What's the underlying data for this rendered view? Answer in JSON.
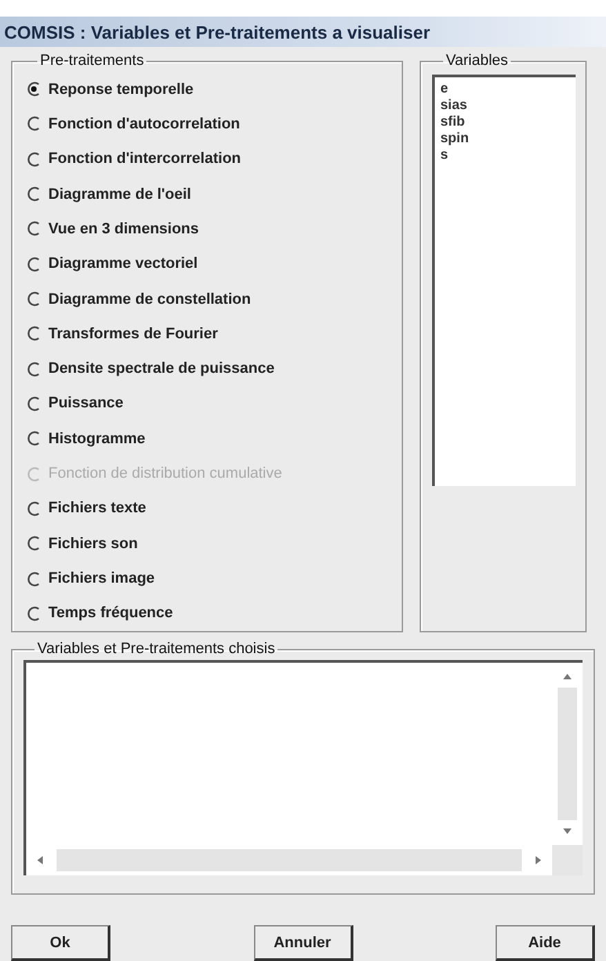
{
  "window": {
    "title": "COMSIS : Variables et Pre-traitements a visualiser"
  },
  "pretraitements": {
    "title": "Pre-traitements",
    "options": [
      {
        "label": "Reponse temporelle",
        "selected": true,
        "disabled": false
      },
      {
        "label": "Fonction d'autocorrelation",
        "selected": false,
        "disabled": false
      },
      {
        "label": "Fonction d'intercorrelation",
        "selected": false,
        "disabled": false
      },
      {
        "label": "Diagramme de l'oeil",
        "selected": false,
        "disabled": false
      },
      {
        "label": "Vue en 3 dimensions",
        "selected": false,
        "disabled": false
      },
      {
        "label": "Diagramme vectoriel",
        "selected": false,
        "disabled": false
      },
      {
        "label": "Diagramme de constellation",
        "selected": false,
        "disabled": false
      },
      {
        "label": "Transformes de Fourier",
        "selected": false,
        "disabled": false
      },
      {
        "label": "Densite spectrale de puissance",
        "selected": false,
        "disabled": false
      },
      {
        "label": "Puissance",
        "selected": false,
        "disabled": false
      },
      {
        "label": "Histogramme",
        "selected": false,
        "disabled": false
      },
      {
        "label": "Fonction de distribution cumulative",
        "selected": false,
        "disabled": true
      },
      {
        "label": "Fichiers texte",
        "selected": false,
        "disabled": false
      },
      {
        "label": "Fichiers son",
        "selected": false,
        "disabled": false
      },
      {
        "label": "Fichiers image",
        "selected": false,
        "disabled": false
      },
      {
        "label": "Temps fréquence",
        "selected": false,
        "disabled": false
      }
    ]
  },
  "variables": {
    "title": "Variables",
    "items": [
      "e",
      "sias",
      "sfib",
      "spin",
      "s"
    ]
  },
  "chosen": {
    "title": "Variables et Pre-traitements choisis"
  },
  "buttons": [
    "Ok",
    "Annuler",
    "Aide"
  ]
}
